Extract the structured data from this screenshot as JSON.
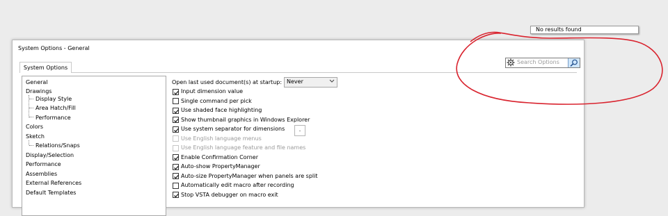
{
  "dialog": {
    "title": "System Options - General",
    "tab": "System Options"
  },
  "search": {
    "placeholder": "Search Options",
    "no_results": "No results found"
  },
  "tree": [
    {
      "label": "General",
      "level": 0,
      "selected": true
    },
    {
      "label": "Drawings",
      "level": 0
    },
    {
      "label": "Display Style",
      "level": 1
    },
    {
      "label": "Area Hatch/Fill",
      "level": 1
    },
    {
      "label": "Performance",
      "level": 1
    },
    {
      "label": "Colors",
      "level": 0
    },
    {
      "label": "Sketch",
      "level": 0
    },
    {
      "label": "Relations/Snaps",
      "level": 1
    },
    {
      "label": "Display/Selection",
      "level": 0
    },
    {
      "label": "Performance",
      "level": 0
    },
    {
      "label": "Assemblies",
      "level": 0
    },
    {
      "label": "External References",
      "level": 0
    },
    {
      "label": "Default Templates",
      "level": 0
    }
  ],
  "startup": {
    "label": "Open last used document(s) at startup:",
    "value": "Never"
  },
  "options": [
    {
      "label": "Input dimension value",
      "checked": true,
      "disabled": false
    },
    {
      "label": "Single command per pick",
      "checked": false,
      "disabled": false
    },
    {
      "label": "Use shaded face highlighting",
      "checked": true,
      "disabled": false
    },
    {
      "label": "Show thumbnail graphics in Windows Explorer",
      "checked": true,
      "disabled": false
    },
    {
      "label": "Use system separator for dimensions",
      "checked": true,
      "disabled": false
    },
    {
      "label": "Use English language menus",
      "checked": false,
      "disabled": true
    },
    {
      "label": "Use English language feature and file names",
      "checked": false,
      "disabled": true
    },
    {
      "label": "Enable Confirmation Corner",
      "checked": true,
      "disabled": false
    },
    {
      "label": "Auto-show PropertyManager",
      "checked": true,
      "disabled": false
    },
    {
      "label": "Auto-size PropertyManager when panels are split",
      "checked": true,
      "disabled": false
    },
    {
      "label": "Automatically edit macro after recording",
      "checked": false,
      "disabled": false
    },
    {
      "label": "Stop VSTA debugger on macro exit",
      "checked": true,
      "disabled": false
    }
  ],
  "separator_value": ".",
  "colors": {
    "annotation": "#d9232e",
    "search_button": "#cfe6fb"
  }
}
